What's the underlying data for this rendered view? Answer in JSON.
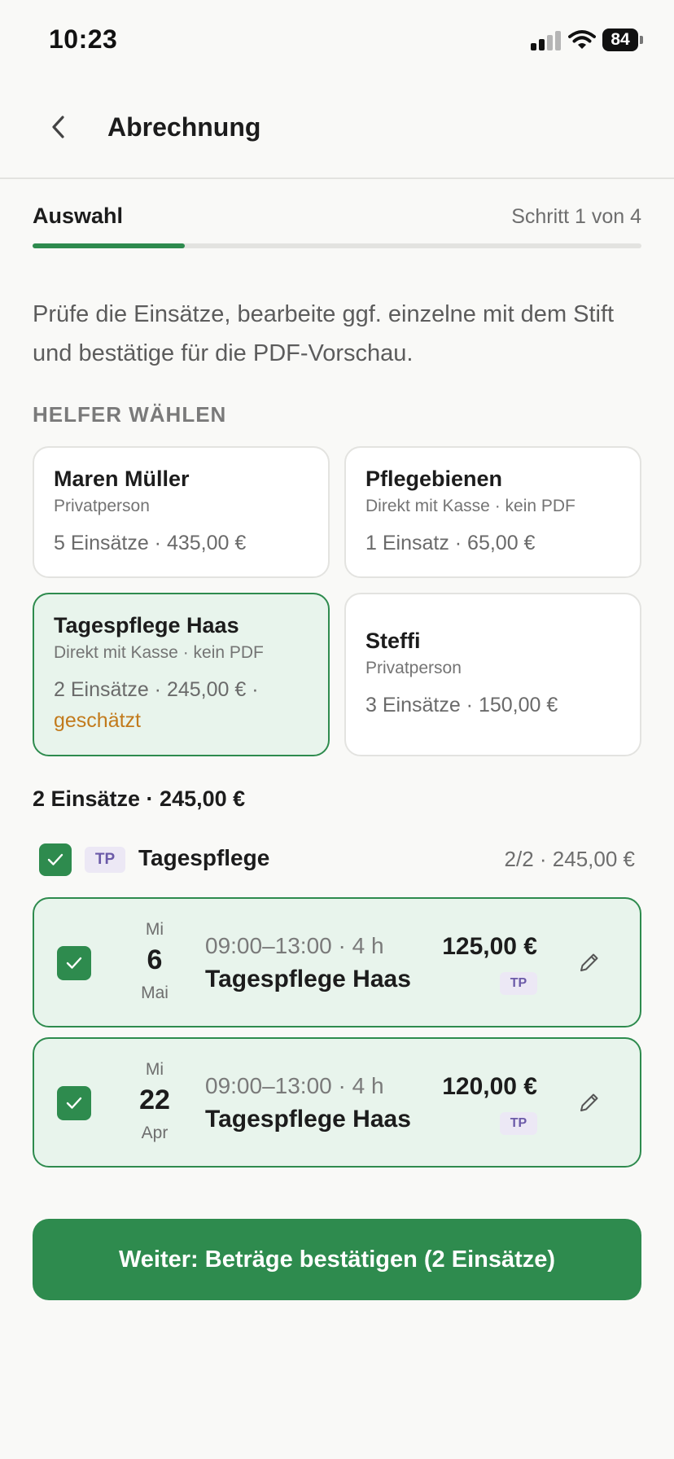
{
  "status_bar": {
    "time": "10:23",
    "battery": "84"
  },
  "header": {
    "title": "Abrechnung"
  },
  "step": {
    "label": "Auswahl",
    "counter": "Schritt 1 von 4",
    "progress": 0.25
  },
  "intro_text": "Prüfe die Einsätze, bearbeite ggf. einzelne mit dem Stift und bestätige für die PDF-Vorschau.",
  "section_heading": "HELFER WÄHLEN",
  "helpers": [
    {
      "name": "Maren Müller",
      "type": "Privatperson",
      "stats": "5 Einsätze · 435,00 €",
      "selected": false
    },
    {
      "name": "Pflegebienen",
      "type": "Direkt mit Kasse · kein PDF",
      "stats": "1 Einsatz · 65,00 €",
      "selected": false
    },
    {
      "name": "Tagespflege Haas",
      "type": "Direkt mit Kasse · kein PDF",
      "stats": "2 Einsätze · 245,00 € ·",
      "estimate": "geschätzt",
      "selected": true
    },
    {
      "name": "Steffi",
      "type": "Privatperson",
      "stats": "3 Einsätze · 150,00 €",
      "selected": false
    }
  ],
  "selection_summary": "2 Einsätze · 245,00 €",
  "group": {
    "badge": "TP",
    "name": "Tagespflege",
    "summary": "2/2 · 245,00 €",
    "checked": true
  },
  "entries": [
    {
      "weekday": "Mi",
      "day": "6",
      "month": "Mai",
      "time": "09:00–13:00 · 4 h",
      "name": "Tagespflege Haas",
      "amount": "125,00 €",
      "badge": "TP",
      "checked": true
    },
    {
      "weekday": "Mi",
      "day": "22",
      "month": "Apr",
      "time": "09:00–13:00 · 4 h",
      "name": "Tagespflege Haas",
      "amount": "120,00 €",
      "badge": "TP",
      "checked": true
    }
  ],
  "primary_button": "Weiter: Beträge bestätigen (2 Einsätze)",
  "colors": {
    "accent": "#2e8b4e",
    "selected_bg": "#e8f4ec",
    "estimate": "#c27a1c",
    "badge_bg": "#ece8f5",
    "badge_text": "#6b5aa8"
  },
  "icons": {
    "back": "chevron-left-icon",
    "check": "checkmark-icon",
    "edit": "pencil-icon"
  }
}
